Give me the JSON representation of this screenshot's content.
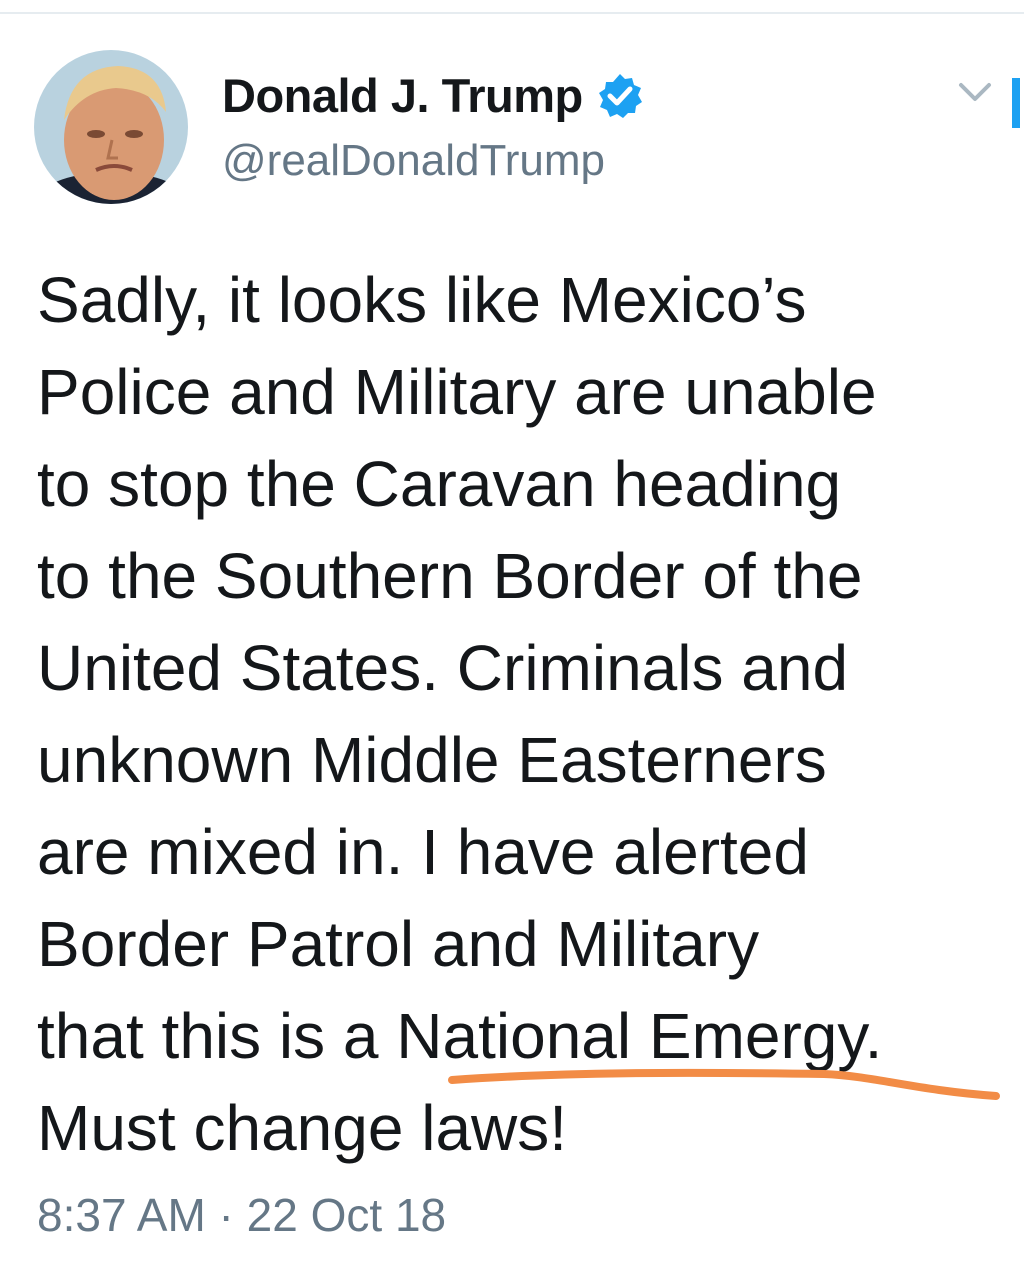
{
  "author": {
    "display_name": "Donald J. Trump",
    "handle": "@realDonaldTrump",
    "verified": true
  },
  "tweet": {
    "text": "Sadly, it looks like Mexico’s\nPolice and Military are unable\nto stop the Caravan heading\nto the Southern Border of the\nUnited States. Criminals and\nunknown Middle Easterners\nare mixed in. I have alerted\nBorder Patrol and Military\nthat this is a National Emergy.\nMust change laws!",
    "timestamp": "8:37 AM · 22 Oct 18"
  },
  "icons": {
    "verified": "verified-badge-icon",
    "menu": "chevron-down-icon"
  },
  "colors": {
    "verified_blue": "#1da1f2",
    "annotation_underline": "#f28c46",
    "secondary_text": "#657786"
  }
}
